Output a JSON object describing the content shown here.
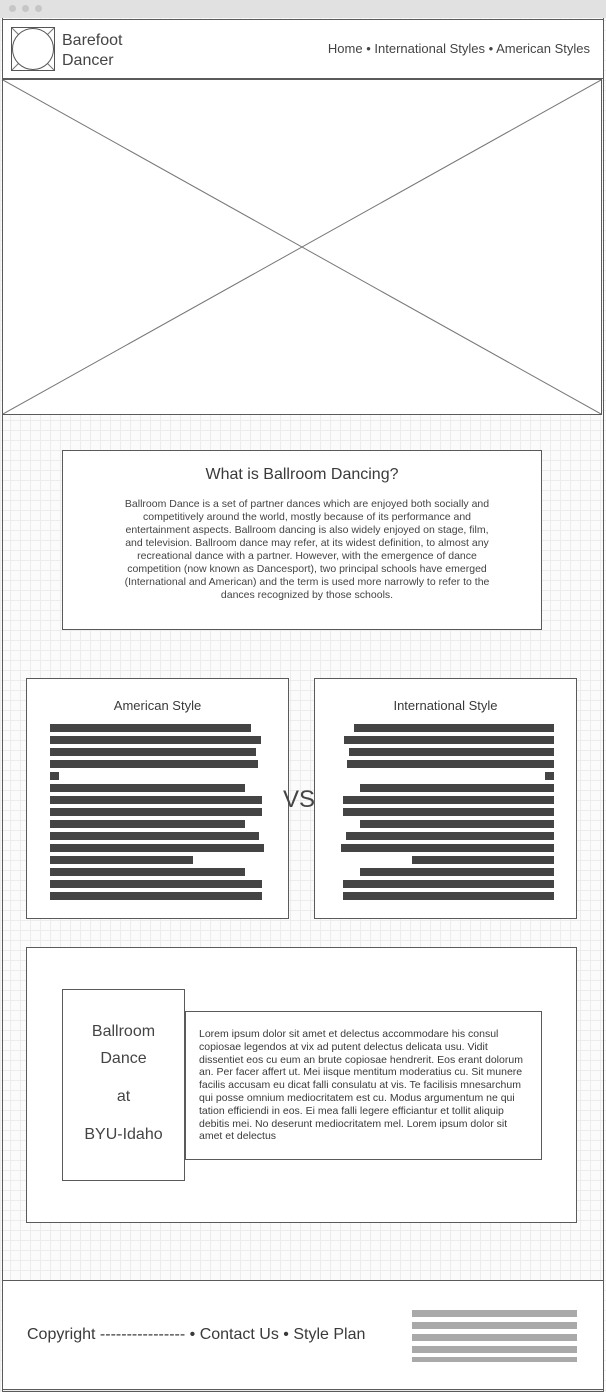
{
  "header": {
    "brand_line1": "Barefoot",
    "brand_line2": "Dancer",
    "nav": [
      "Home",
      "International Styles",
      "American Styles"
    ],
    "nav_separator": "•"
  },
  "hero": {
    "image_placeholder": "image-placeholder"
  },
  "intro": {
    "title": "What is Ballroom Dancing?",
    "body": "Ballroom Dance is a set of partner dances which are enjoyed both socially and competitively around the world, mostly because of its performance and entertainment aspects. Ballroom dancing is also widely enjoyed on stage, film, and television. Ballroom dance may refer, at its widest definition, to almost any recreational dance with a partner. However, with the emergence of dance competition (now known as Dancesport), two principal schools have emerged (International and American) and the term is used more narrowly to refer to the dances recognized by those schools."
  },
  "comparison": {
    "american_title": "American Style",
    "international_title": "International Style",
    "vs_label": "VS"
  },
  "byu": {
    "line1": "Ballroom",
    "line2": "Dance",
    "line3": "at",
    "line4": "BYU-Idaho",
    "body": "Lorem ipsum dolor sit amet et delectus accommodare his consul copiosae legendos at vix ad putent delectus delicata usu. Vidit dissentiet eos cu eum an brute copiosae hendrerit. Eos erant dolorum an. Per facer affert ut. Mei iisque mentitum moderatius cu. Sit munere facilis accusam eu dicat falli consulatu at vis. Te facilisis mnesarchum qui posse omnium mediocritatem est cu. Modus argumentum ne qui tation efficiendi in eos. Ei mea falli legere efficiantur et tollit aliquip debitis mei. No deserunt mediocritatem mel. Lorem ipsum dolor sit amet et delectus"
  },
  "footer": {
    "copyright": "Copyright ----------------",
    "separator": "•",
    "contact": "Contact Us",
    "style_plan": "Style Plan"
  },
  "colors": {
    "border": "#5a5a5a",
    "text_bar": "#444444",
    "footer_bar": "#a9a9a9",
    "grid_line": "#ececec"
  }
}
